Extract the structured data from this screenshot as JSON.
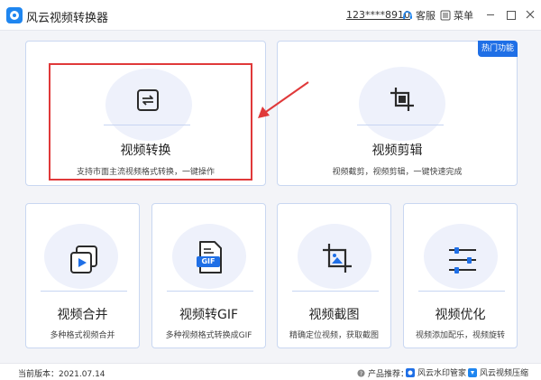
{
  "window": {
    "title": "风云视频转换器",
    "user_id": "123****8910",
    "service_label": "客服",
    "menu_label": "菜单"
  },
  "features": {
    "hot_badge": "热门功能",
    "convert": {
      "title": "视频转换",
      "desc": "支持市面主流视频格式转换，一键操作"
    },
    "edit": {
      "title": "视频剪辑",
      "desc": "视频截剪，视频剪辑，一键快速完成"
    },
    "merge": {
      "title": "视频合并",
      "desc": "多种格式视频合并"
    },
    "gif": {
      "title": "视频转GIF",
      "desc": "多种视频格式转换成GIF",
      "icon_text": "GIF"
    },
    "screenshot": {
      "title": "视频截图",
      "desc": "精确定位视频，获取截图"
    },
    "optimize": {
      "title": "视频优化",
      "desc": "视频添加配乐，视频旋转"
    }
  },
  "statusbar": {
    "version": "当前版本：2021.07.14",
    "recommend_label": "产品推荐：",
    "rec_1": "风云水印管家",
    "rec_2": "风云视频压缩"
  },
  "colors": {
    "accent": "#1f6fe6",
    "highlight": "#e0393a",
    "card_border": "#c9d7f1"
  }
}
